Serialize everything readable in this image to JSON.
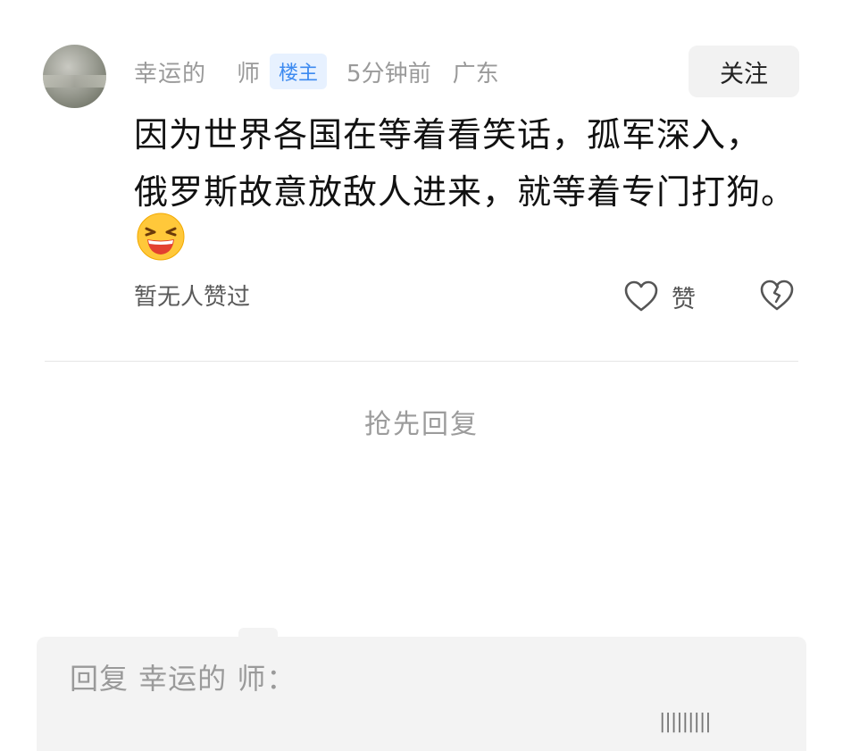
{
  "comment": {
    "author_prefix": "幸运的",
    "author_suffix": "师",
    "op_badge": "楼主",
    "time": "5分钟前",
    "location": "广东",
    "follow_label": "关注",
    "line1": "因为世界各国在等着看笑话，孤军深入，",
    "line2": "俄罗斯故意放敌人进来，就等着专门打狗。",
    "emoji": "laughing-emoji",
    "likes_text": "暂无人赞过",
    "like_label": "赞"
  },
  "reply": {
    "first_reply": "抢先回复",
    "placeholder": "回复 幸运的  师："
  },
  "watermark": "|||||||||"
}
